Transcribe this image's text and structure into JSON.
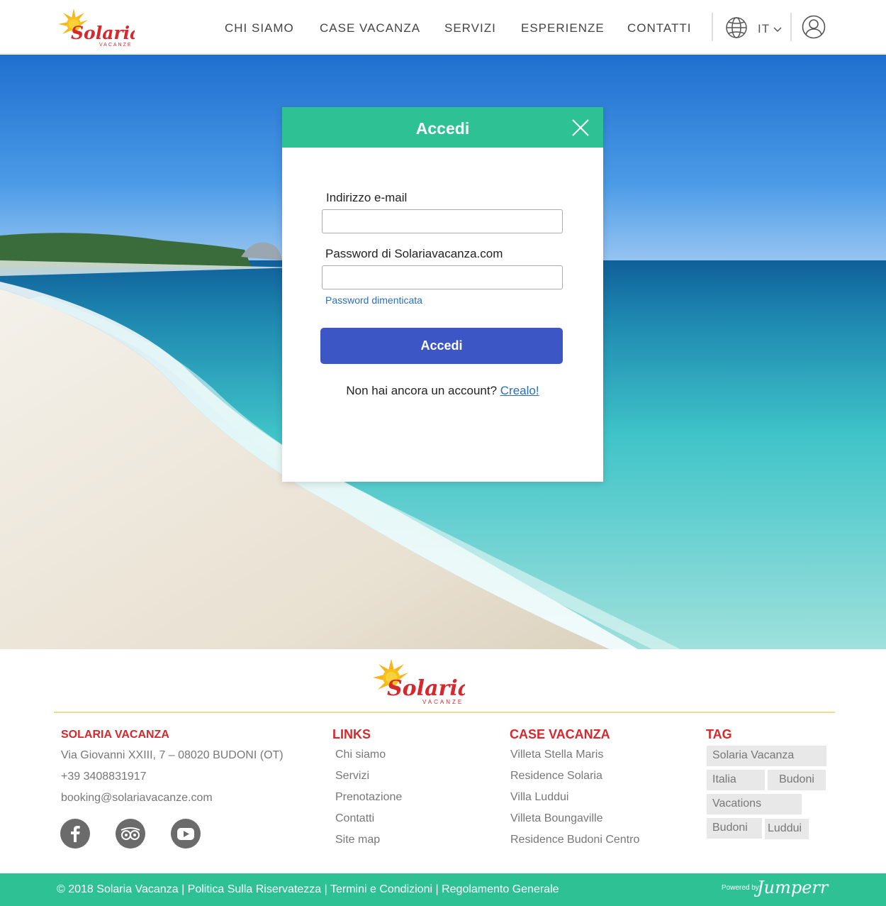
{
  "brand": {
    "name": "Solaria",
    "sub": "VACANZE"
  },
  "nav": {
    "items": [
      "CHI SIAMO",
      "CASE VACANZA",
      "SERVIZI",
      "ESPERIENZE",
      "CONTATTI"
    ],
    "lang": "IT"
  },
  "modal": {
    "title": "Accedi",
    "email_label": "Indirizzo e-mail",
    "email_value": "",
    "password_label": "Password di Solariavacanza.com",
    "password_value": "",
    "forgot": "Password dimenticata",
    "submit": "Accedi",
    "signup_prompt": "Non hai ancora un account?",
    "signup_link": "Crealo!"
  },
  "footer": {
    "company": {
      "title": "SOLARIA VACANZA",
      "address": "Via Giovanni XXIII, 7 – 08020 BUDONI (OT)",
      "phone": "+39 3408831917",
      "email": "booking@solariavacanze.com"
    },
    "links": {
      "title": "LINKS",
      "items": [
        "Chi siamo",
        "Servizi",
        "Prenotazione",
        "Contatti",
        "Site map"
      ]
    },
    "houses": {
      "title": "CASE VACANZA",
      "items": [
        "Villeta Stella Maris",
        "Residence Solaria",
        "Villa Luddui",
        "Villeta Boungaville",
        "Residence Budoni Centro"
      ]
    },
    "tags": {
      "title": "TAG",
      "items": [
        "Solaria Vacanza",
        "Italia",
        "Budoni",
        "Vacations",
        "Budoni",
        "Luddui"
      ]
    },
    "social": [
      "facebook-icon",
      "tripadvisor-icon",
      "youtube-icon"
    ]
  },
  "bottom": {
    "copyright": "© 2018 Solaria Vacanza",
    "privacy": "Politica Sulla Riservatezza",
    "terms": "Termini e Condizioni",
    "rules": "Regolamento Generale",
    "powered_by": "Powered by:",
    "powered_brand": "Jumperr"
  },
  "colors": {
    "accent": "#2ec194",
    "button": "#3d56c6",
    "brand_red": "#d6282d",
    "rule": "#f2d88a"
  }
}
